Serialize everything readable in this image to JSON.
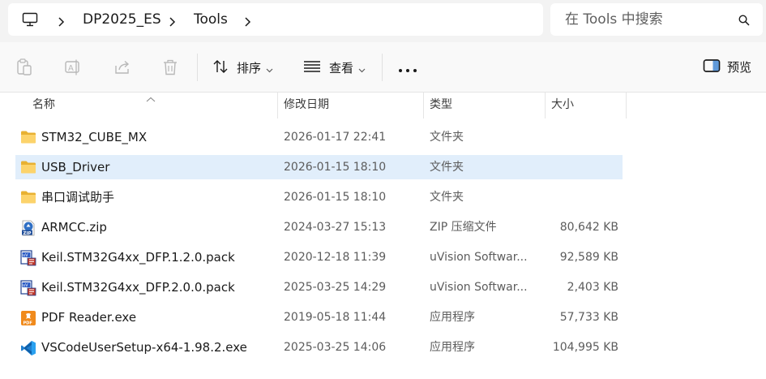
{
  "address": {
    "crumbs": [
      "DP2025_ES",
      "Tools"
    ]
  },
  "search": {
    "placeholder": "在 Tools 中搜索"
  },
  "toolbar": {
    "sort_label": "排序",
    "view_label": "查看",
    "preview_label": "预览"
  },
  "columns": {
    "name": "名称",
    "date": "修改日期",
    "type": "类型",
    "size": "大小"
  },
  "files": [
    {
      "name": "STM32_CUBE_MX",
      "date": "2026-01-17 22:41",
      "type": "文件夹",
      "size": "",
      "icon": "folder-icon"
    },
    {
      "name": "USB_Driver",
      "date": "2026-01-15 18:10",
      "type": "文件夹",
      "size": "",
      "icon": "folder-icon"
    },
    {
      "name": "串口调试助手",
      "date": "2026-01-15 18:10",
      "type": "文件夹",
      "size": "",
      "icon": "folder-icon"
    },
    {
      "name": "ARMCC.zip",
      "date": "2024-03-27 15:13",
      "type": "ZIP 压缩文件",
      "size": "80,642 KB",
      "icon": "zip-file-icon"
    },
    {
      "name": "Keil.STM32G4xx_DFP.1.2.0.pack",
      "date": "2020-12-18 11:39",
      "type": "uVision Softwar...",
      "size": "92,589 KB",
      "icon": "uvision-pack-icon"
    },
    {
      "name": "Keil.STM32G4xx_DFP.2.0.0.pack",
      "date": "2025-03-25 14:29",
      "type": "uVision Softwar...",
      "size": "2,403 KB",
      "icon": "uvision-pack-icon"
    },
    {
      "name": "PDF Reader.exe",
      "date": "2019-05-18 11:44",
      "type": "应用程序",
      "size": "57,733 KB",
      "icon": "pdf-reader-icon"
    },
    {
      "name": "VSCodeUserSetup-x64-1.98.2.exe",
      "date": "2025-03-25 14:06",
      "type": "应用程序",
      "size": "104,995 KB",
      "icon": "vscode-icon"
    }
  ]
}
